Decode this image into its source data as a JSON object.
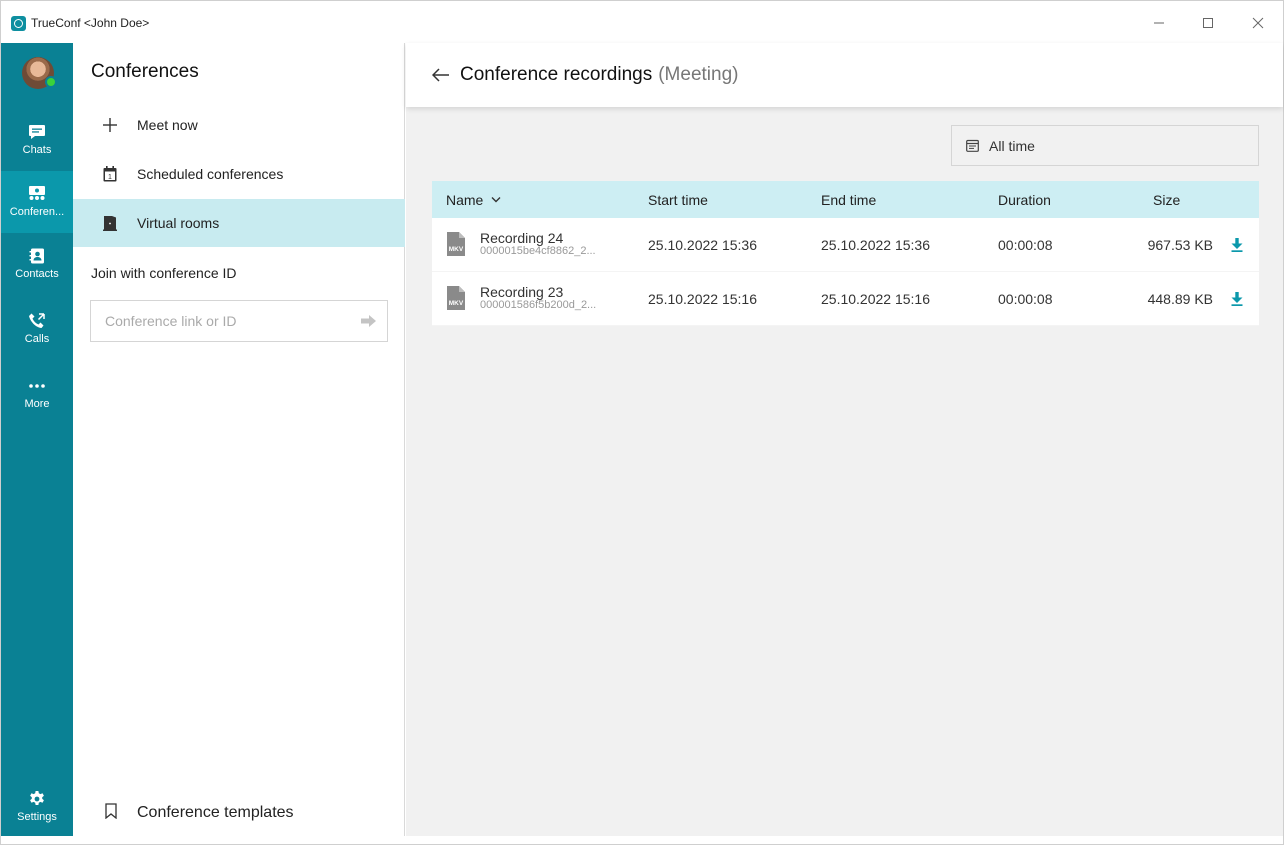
{
  "window": {
    "title": "TrueConf <John Doe>",
    "controls": [
      "minimize-icon",
      "maximize-icon",
      "close-icon"
    ]
  },
  "rail": {
    "items": [
      {
        "label": "Chats",
        "icon": "chat-icon"
      },
      {
        "label": "Conferen...",
        "icon": "conference-icon",
        "active": true
      },
      {
        "label": "Contacts",
        "icon": "contacts-icon"
      },
      {
        "label": "Calls",
        "icon": "calls-icon"
      },
      {
        "label": "More",
        "icon": "more-icon"
      },
      {
        "label": "Settings",
        "icon": "gear-icon"
      }
    ],
    "color": "#0a8194",
    "active_color": "#0b98ab",
    "accent": "#f28c1a"
  },
  "sidebar": {
    "title": "Conferences",
    "items": [
      {
        "label": "Meet now",
        "icon": "plus-icon"
      },
      {
        "label": "Scheduled conferences",
        "icon": "calendar-icon"
      },
      {
        "label": "Virtual rooms",
        "icon": "door-icon",
        "selected": true
      }
    ],
    "join_label": "Join with conference ID",
    "join_placeholder": "Conference link or ID",
    "templates_label": "Conference templates"
  },
  "main": {
    "title": "Conference recordings",
    "subtitle": "(Meeting)",
    "filter": "All time",
    "columns": [
      "Name",
      "Start time",
      "End time",
      "Duration",
      "Size"
    ],
    "rows": [
      {
        "name": "Recording 24",
        "id": "0000015be4cf8862_2...",
        "format": "MKV",
        "start": "25.10.2022 15:36",
        "end": "25.10.2022 15:36",
        "duration": "00:00:08",
        "size": "967.53 KB"
      },
      {
        "name": "Recording 23",
        "id": "000001586f5b200d_2...",
        "format": "MKV",
        "start": "25.10.2022 15:16",
        "end": "25.10.2022 15:16",
        "duration": "00:00:08",
        "size": "448.89 KB"
      }
    ],
    "header_color": "#cdeef3",
    "download_color": "#0b98ab"
  }
}
